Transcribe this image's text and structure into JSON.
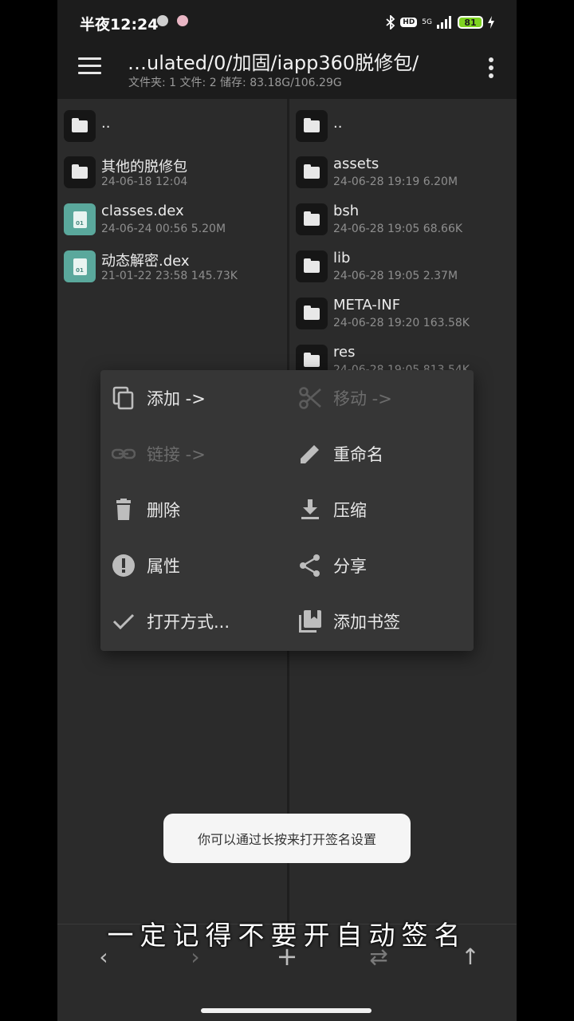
{
  "status_bar": {
    "time": "半夜12:24",
    "battery": "81",
    "net": "5G",
    "hd": "HD"
  },
  "toolbar": {
    "path": "…ulated/0/加固/iapp360脱修包/",
    "stats": "文件夹: 1  文件: 2  储存: 83.18G/106.29G"
  },
  "left_pane": {
    "items": [
      {
        "name": "..",
        "meta": "",
        "icon": "folder-icon"
      },
      {
        "name": "其他的脱修包",
        "meta": "24-06-18 12:04",
        "icon": "folder-icon"
      },
      {
        "name": "classes.dex",
        "meta": "24-06-24 00:56  5.20M",
        "icon": "dex-file-icon"
      },
      {
        "name": "动态解密.dex",
        "meta": "21-01-22 23:58  145.73K",
        "icon": "dex-file-icon"
      }
    ]
  },
  "right_pane": {
    "items": [
      {
        "name": "..",
        "meta": "",
        "icon": "folder-icon"
      },
      {
        "name": "assets",
        "meta": "24-06-28 19:19  6.20M",
        "icon": "folder-icon"
      },
      {
        "name": "bsh",
        "meta": "24-06-28 19:05  68.66K",
        "icon": "folder-icon"
      },
      {
        "name": "lib",
        "meta": "24-06-28 19:05  2.37M",
        "icon": "folder-icon"
      },
      {
        "name": "META-INF",
        "meta": "24-06-28 19:20  163.58K",
        "icon": "folder-icon"
      },
      {
        "name": "res",
        "meta": "24-06-28 19:05  813.54K",
        "icon": "folder-icon"
      }
    ]
  },
  "context_menu": {
    "items": [
      {
        "label": "添加 ->",
        "icon": "copy-icon",
        "enabled": true
      },
      {
        "label": "移动 ->",
        "icon": "cut-icon",
        "enabled": false
      },
      {
        "label": "链接 ->",
        "icon": "link-icon",
        "enabled": false
      },
      {
        "label": "重命名",
        "icon": "pencil-icon",
        "enabled": true
      },
      {
        "label": "删除",
        "icon": "trash-icon",
        "enabled": true
      },
      {
        "label": "压缩",
        "icon": "download-icon",
        "enabled": true
      },
      {
        "label": "属性",
        "icon": "info-icon",
        "enabled": true
      },
      {
        "label": "分享",
        "icon": "share-icon",
        "enabled": true
      },
      {
        "label": "打开方式...",
        "icon": "check-icon",
        "enabled": true
      },
      {
        "label": "添加书签",
        "icon": "bookmark-icon",
        "enabled": true
      }
    ]
  },
  "toast": "你可以通过长按来打开签名设置",
  "caption": "一定记得不要开自动签名",
  "bottom_bar": {
    "back": "‹",
    "forward": "›",
    "add": "+",
    "swap": "⇄",
    "up": "↑"
  },
  "colors": {
    "background": "#2b2b2b",
    "toolbar": "#1c1c1c",
    "menu": "#363636",
    "dex_accent": "#5aa89c",
    "battery": "#7ed321"
  }
}
